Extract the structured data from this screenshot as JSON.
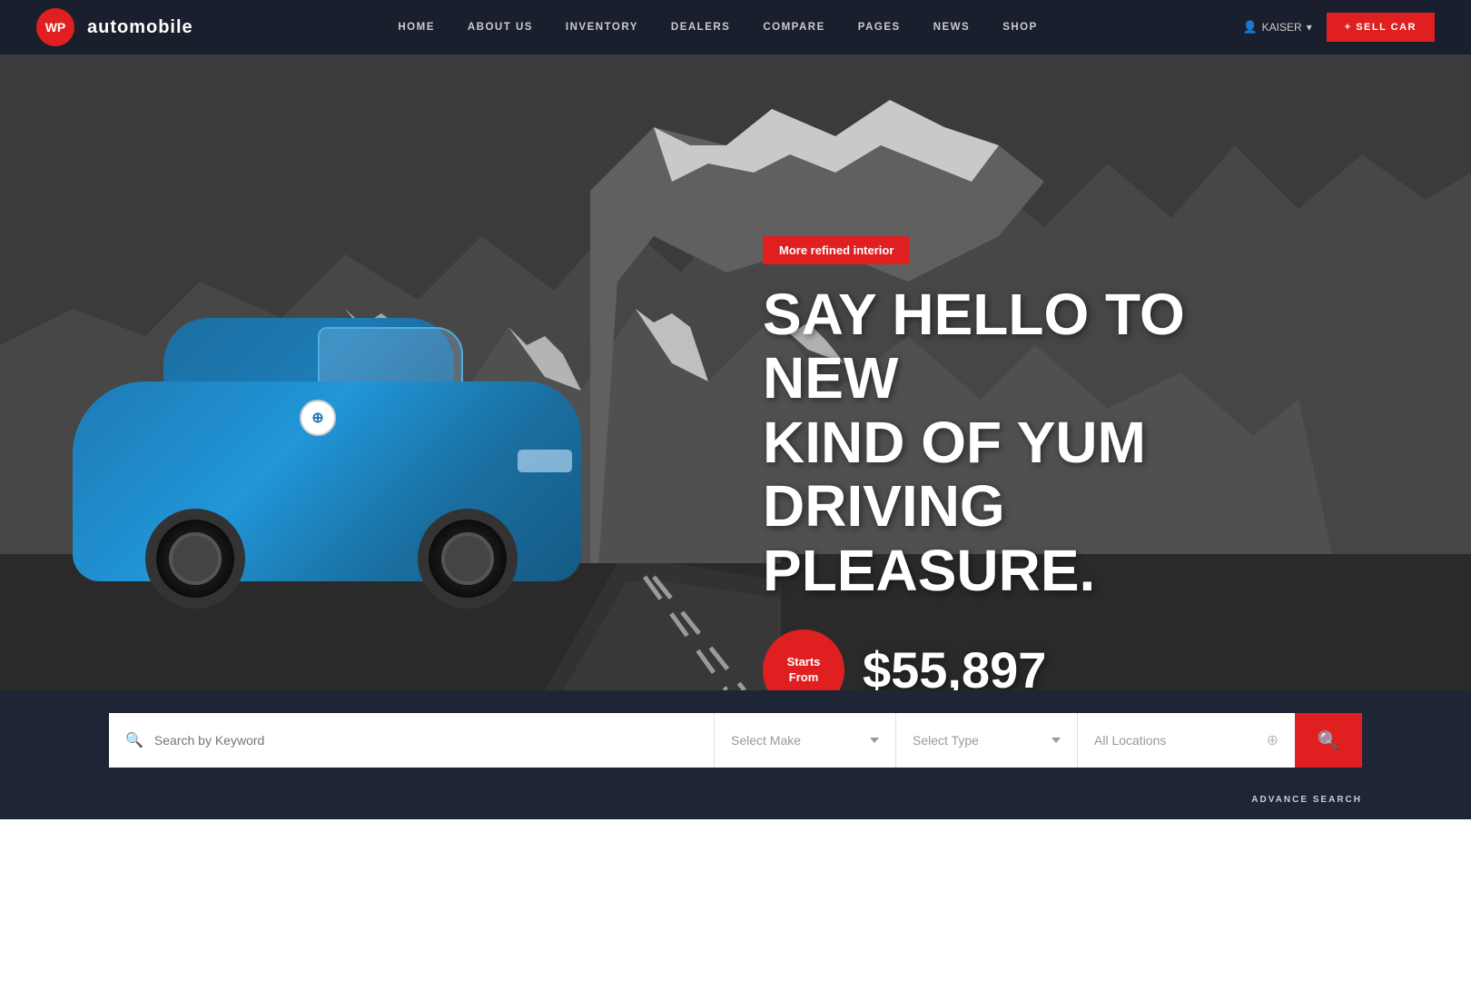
{
  "brand": {
    "logo_text": "WP",
    "name": "automobile"
  },
  "nav": {
    "links": [
      "HOME",
      "ABOUT US",
      "INVENTORY",
      "DEALERS",
      "COMPARE",
      "PAGES",
      "NEWS",
      "SHOP"
    ],
    "user_label": "KAISER",
    "sell_car_label": "+ SELL CAR"
  },
  "hero": {
    "badge_text": "More refined interior",
    "title_line1": "SAY HELLO TO NEW",
    "title_line2": "KIND OF YUM",
    "title_line3": "DRIVING PLEASURE.",
    "starts_from_line1": "Starts",
    "starts_from_line2": "From",
    "price": "$55,897"
  },
  "search": {
    "keyword_placeholder": "Search by Keyword",
    "make_placeholder": "Select Make",
    "type_placeholder": "Select Type",
    "location_placeholder": "All Locations",
    "advance_label": "ADVANCE SEARCH"
  },
  "colors": {
    "brand_red": "#e02020",
    "navbar_bg": "#1a1f2e",
    "search_bg": "#1e2535"
  }
}
